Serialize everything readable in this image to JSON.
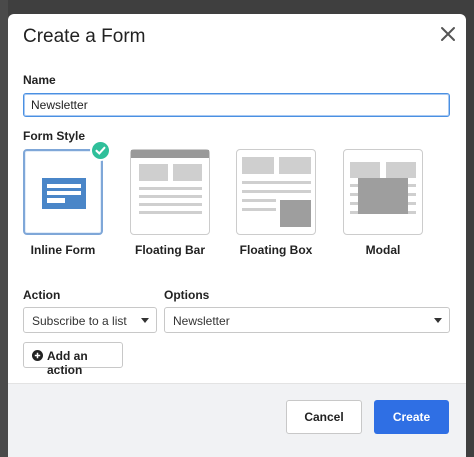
{
  "dialog": {
    "title": "Create a Form",
    "close_icon": "close-icon"
  },
  "name_field": {
    "label": "Name",
    "value": "Newsletter"
  },
  "form_style": {
    "label": "Form Style",
    "selected": "Inline Form",
    "options": [
      {
        "label": "Inline Form",
        "icon": "inline-form-icon"
      },
      {
        "label": "Floating Bar",
        "icon": "floating-bar-icon"
      },
      {
        "label": "Floating Box",
        "icon": "floating-box-icon"
      },
      {
        "label": "Modal",
        "icon": "modal-icon"
      }
    ]
  },
  "action": {
    "label": "Action",
    "selected": "Subscribe to a list"
  },
  "options": {
    "label": "Options",
    "selected": "Newsletter"
  },
  "add_action": {
    "label": "Add an action",
    "icon": "plus-circle-icon"
  },
  "footer": {
    "cancel_label": "Cancel",
    "create_label": "Create"
  },
  "colors": {
    "primary": "#2f6fe4",
    "check": "#2fbf9a",
    "selected_border": "#7fa7d8"
  }
}
